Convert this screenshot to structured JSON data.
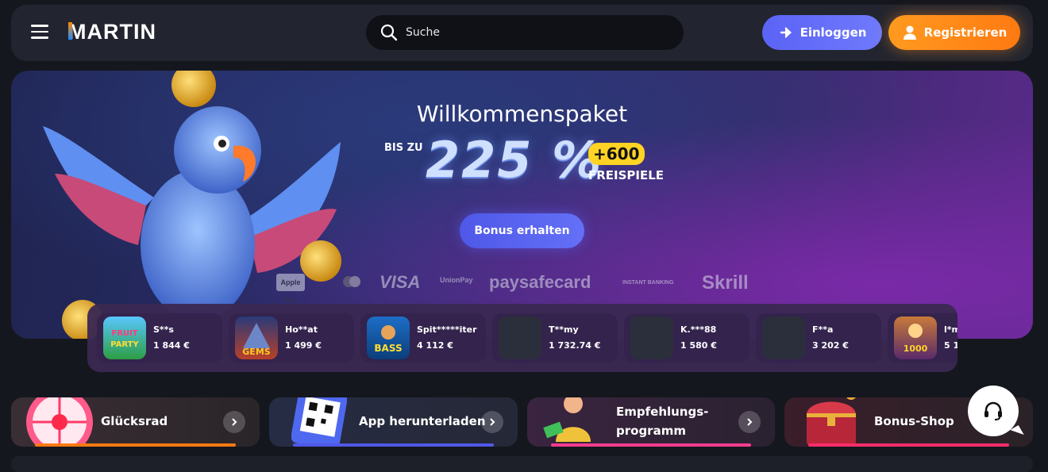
{
  "header": {
    "menu_icon": "hamburger-icon",
    "logo_text": "MARTIN",
    "search_placeholder": "Suche",
    "login_label": "Einloggen",
    "register_label": "Registrieren",
    "colors": {
      "login": "#5b63f5",
      "register": "#ff8a1a",
      "header_bg": "#22252f"
    }
  },
  "hero": {
    "title": "Willkommenspaket",
    "bis_zu": "BIS ZU",
    "percent": "225 %",
    "plus": "+600",
    "freispiele": "FREISPIELE",
    "cta": "Bonus erhalten",
    "payments": [
      "Apple Pay",
      "VISA",
      "UnionPay",
      "paysafecard",
      "INSTANT BANKING",
      "Skrill"
    ]
  },
  "winners": [
    {
      "name": "S**s",
      "amount": "1 844 €",
      "thumb": "fruit-party"
    },
    {
      "name": "Ho**at",
      "amount": "1 499 €",
      "thumb": "eagle-gems"
    },
    {
      "name": "Spit*****iter",
      "amount": "4 112 €",
      "thumb": "bigger-bass"
    },
    {
      "name": "T**my",
      "amount": "1 732.74 €",
      "thumb": ""
    },
    {
      "name": "K.***88",
      "amount": "1 580 €",
      "thumb": ""
    },
    {
      "name": "F**a",
      "amount": "3 202 €",
      "thumb": ""
    },
    {
      "name": "l*m",
      "amount": "5 1",
      "thumb": "gates-of-olympus-1000"
    }
  ],
  "promos": [
    {
      "label": "Glücksrad",
      "icon": "wheel-icon",
      "bar": "#ff7a12"
    },
    {
      "label": "App herunterladen",
      "icon": "qr-code-icon",
      "bar": "#4f58e8"
    },
    {
      "label": "Empfehlungs-",
      "label2": "programm",
      "icon": "referral-icon",
      "bar": "#ff3d8f"
    },
    {
      "label": "Bonus-Shop",
      "icon": "treasure-chest-icon",
      "bar": "#ff2d6a"
    }
  ]
}
